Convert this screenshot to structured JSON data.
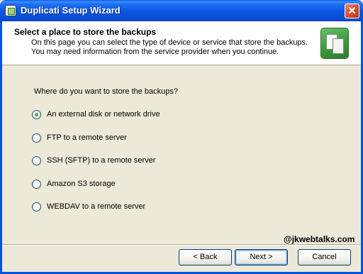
{
  "window": {
    "title": "Duplicati Setup Wizard",
    "close_glyph": "✕"
  },
  "header": {
    "title": "Select a place to store the backups",
    "description": "On this page you can select the type of device or service that store the backups. You may need information from the service provider when you continue.",
    "icon": "backup-documents-icon"
  },
  "main": {
    "question": "Where do you want to store the backups?",
    "options": [
      {
        "label": "An external disk or network drive",
        "checked": true
      },
      {
        "label": "FTP to a remote server",
        "checked": false
      },
      {
        "label": "SSH (SFTP) to a remote server",
        "checked": false
      },
      {
        "label": "Amazon S3 storage",
        "checked": false
      },
      {
        "label": "WEBDAV to a remote server",
        "checked": false
      }
    ],
    "watermark": "@jkwebtalks.com"
  },
  "footer": {
    "back_label": "< Back",
    "next_label": "Next >",
    "cancel_label": "Cancel"
  }
}
